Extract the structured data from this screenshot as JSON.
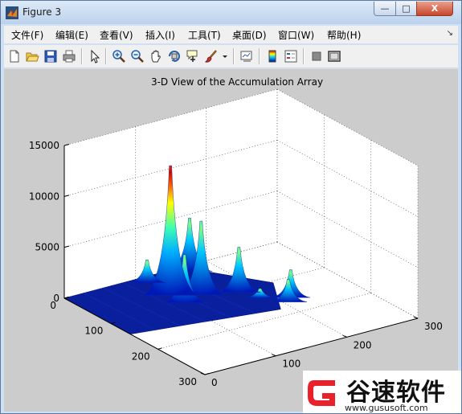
{
  "window": {
    "title": "Figure 3",
    "controls": {
      "minimize": "—",
      "maximize": "□",
      "close": "X"
    }
  },
  "menu": {
    "items": [
      "文件(F)",
      "编辑(E)",
      "查看(V)",
      "插入(I)",
      "工具(T)",
      "桌面(D)",
      "窗口(W)",
      "帮助(H)"
    ],
    "overflow_arrow": "↘"
  },
  "toolbar": {
    "buttons": [
      "new-figure-icon",
      "open-file-icon",
      "save-icon",
      "print-icon",
      "pointer-icon",
      "zoom-in-icon",
      "zoom-out-icon",
      "pan-hand-icon",
      "rotate-3d-icon",
      "data-cursor-icon",
      "brush-icon",
      "dropdown-arrow-icon",
      "link-plot-icon",
      "colorbar-icon",
      "legend-icon",
      "hide-plot-tools-icon",
      "show-plot-tools-icon"
    ]
  },
  "chart_data": {
    "type": "surface",
    "title": "3-D View of the Accumulation Array",
    "xlabel": "",
    "ylabel": "",
    "zlabel": "",
    "x_range": [
      0,
      300
    ],
    "y_range": [
      0,
      300
    ],
    "z_range": [
      0,
      15000
    ],
    "x_ticks": [
      "0",
      "100",
      "200",
      "300"
    ],
    "y_ticks": [
      "0",
      "100",
      "200",
      "300"
    ],
    "z_ticks": [
      "0",
      "5000",
      "10000",
      "15000"
    ],
    "grid": true,
    "colormap": "jet",
    "peaks": [
      {
        "x": 60,
        "y": 110,
        "z": 12500
      },
      {
        "x": 80,
        "y": 140,
        "z": 7000
      },
      {
        "x": 90,
        "y": 110,
        "z": 4500
      },
      {
        "x": 100,
        "y": 180,
        "z": 4200
      },
      {
        "x": 10,
        "y": 170,
        "z": 5000
      },
      {
        "x": 10,
        "y": 110,
        "z": 2000
      },
      {
        "x": 150,
        "y": 220,
        "z": 2500
      },
      {
        "x": 160,
        "y": 210,
        "z": 2000
      },
      {
        "x": 130,
        "y": 190,
        "z": 700
      }
    ]
  },
  "watermark": {
    "name": "谷速软件",
    "url": "www.gususoft.com",
    "brand_color": "#e8212b"
  }
}
